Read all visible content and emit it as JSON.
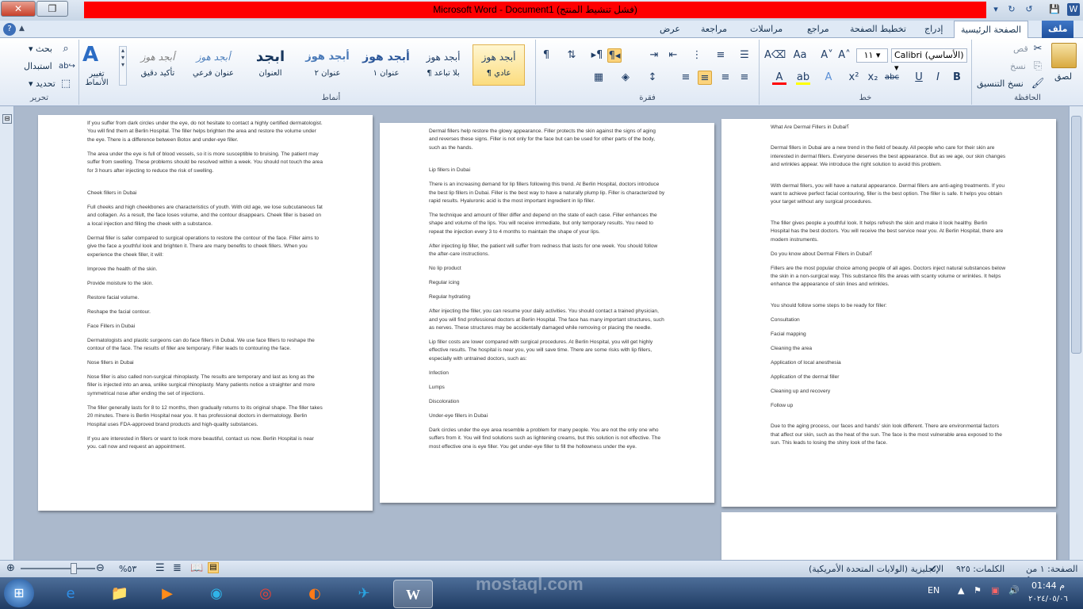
{
  "window": {
    "title": "Microsoft Word - Document1 (فشل تنشيط المنتج)",
    "buttons": {
      "minimize": "▁",
      "restore": "❐",
      "close": "✕"
    }
  },
  "tabs": [
    "ملف",
    "الصفحة الرئيسية",
    "إدراج",
    "تخطيط الصفحة",
    "مراجع",
    "مراسلات",
    "مراجعة",
    "عرض"
  ],
  "ribbon": {
    "clipboard": {
      "label": "الحافظة",
      "paste": "لصق",
      "cut": "قص",
      "copy": "نسخ",
      "format_painter": "نسخ التنسيق"
    },
    "font": {
      "label": "خط",
      "font_name": "Calibri (الأساسي)",
      "font_size": "١١"
    },
    "paragraph": {
      "label": "فقرة"
    },
    "styles": {
      "label": "أنماط",
      "items": [
        {
          "sample": "أبجد هوز",
          "name": "¶ عادي"
        },
        {
          "sample": "أبجد هوز",
          "name": "¶ بلا تباعد"
        },
        {
          "sample": "أبجد هوز",
          "name": "عنوان ١"
        },
        {
          "sample": "أبجد هوز",
          "name": "عنوان ٢"
        },
        {
          "sample": "ابجد",
          "name": "العنوان"
        },
        {
          "sample": "أبجد هوز",
          "name": "عنوان فرعي"
        },
        {
          "sample": "أبجد هوز",
          "name": "تأكيد دقيق"
        }
      ],
      "change_styles": "تغيير الأنماط"
    },
    "editing": {
      "label": "تحرير",
      "find": "بحث",
      "replace": "استبدال",
      "select": "تحديد"
    }
  },
  "pages": [
    {
      "paragraphs": [
        "What Are Dermal Fillers in Dubai؟",
        "Dermal fillers in Dubai are a new trend in the field of beauty. All people who care for their skin are interested in dermal fillers. Everyone deserves the best appearance. But as we age, our skin changes and wrinkles appear. We introduce the right solution to avoid this problem.",
        "With dermal fillers, you will have a natural appearance. Dermal fillers are anti-aging treatments. If you want to achieve perfect facial contouring, filler is the best option. The filler is safe. It helps you obtain your target without any surgical procedures.",
        "The filler gives people a youthful look. It helps refresh the skin and make it look healthy. Berlin Hospital has the best doctors. You will receive the best service near you. At Berlin Hospital, there are modern instruments.",
        "Do you know about Dermal Fillers in Dubai؟",
        "Fillers are the most popular choice among people of all ages. Doctors inject natural substances below the skin in a non-surgical way. This substance fills the areas with scanty volume or wrinkles. It helps enhance the appearance of skin lines and wrinkles.",
        "You should follow some steps to be ready for filler:",
        "Consultation",
        "Facial mapping",
        "Cleaning the area",
        "Application of local anesthesia",
        "Application of the dermal filler",
        "Cleaning up and recovery",
        "Follow up",
        "Due to the aging process, our faces and hands' skin look different. There are environmental factors that affect our skin, such as the heat of the sun. The face is the most vulnerable area exposed to the sun. This leads to losing the shiny look of the face."
      ]
    },
    {
      "paragraphs": [
        "Dermal fillers help restore the glowy appearance. Filler protects the skin against the signs of aging and reverses these signs. Filler is not only for the face but can be used for other parts of the body, such as the hands.",
        "Lip fillers in Dubai",
        "There is an increasing demand for lip fillers following this trend. At Berlin Hospital, doctors introduce the best lip fillers in Dubai. Filler is the best way to have a naturally plump lip. Filler is characterized by rapid results. Hyaluronic acid is the most important ingredient in lip filler.",
        "The technique and amount of filler differ and depend on the state of each case. Filler enhances the shape and volume of the lips. You will receive immediate, but only temporary results. You need to repeat the injection every 3 to 4 months to maintain the shape of your lips.",
        "After injecting lip filler, the patient will suffer from redness that lasts for one week. You should follow the after-care instructions.",
        "No lip product",
        "Regular icing",
        "Regular hydrating",
        "After injecting the filler, you can resume your daily activities. You should contact a trained physician, and you will find professional doctors at Berlin Hospital. The face has many important structures, such as nerves. These structures may be accidentally damaged while removing or placing the needle.",
        "Lip filler costs are lower compared with surgical procedures. At Berlin Hospital, you will get highly effective results. The hospital is near you, you will save time. There are some risks with lip fillers, especially with untrained doctors, such as:",
        "Infection",
        "Lumps",
        "Discoloration",
        "Under-eye fillers in Dubai",
        "Dark circles under the eye area resemble a problem for many people. You are not the only one who suffers from it. You will find solutions such as lightening creams, but this solution is not effective. The most effective one is eye filler. You get under-eye filler to fill the hollowness under the eye."
      ]
    },
    {
      "paragraphs": [
        "If you suffer from dark circles under the eye, do not hesitate to contact a highly certified dermatologist. You will find them at Berlin Hospital. The filler helps brighten the area and restore the volume under the eye. There is a difference between Botox and under-eye filler.",
        "The area under the eye is full of blood vessels, so it is more susceptible to bruising. The patient may suffer from swelling. These problems should be resolved within a week. You should not touch the area for 3 hours after injecting to reduce the risk of swelling.",
        "Cheek fillers in Dubai",
        "Full cheeks and high cheekbones are characteristics of youth. With old age, we lose subcutaneous fat and collagen. As a result, the face loses volume, and the contour disappears. Cheek filler is based on a local injection and filling the cheek with a substance.",
        "Dermal filler is safer compared to surgical operations to restore the contour of the face. Filler aims to give the face a youthful look and brighten it. There are many benefits to cheek fillers. When you experience the cheek filler, it will:",
        "Improve the health of the skin.",
        "Provide moisture to the skin.",
        "Restore facial volume.",
        "Reshape the facial contour.",
        "Face Fillers in Dubai",
        "Dermatologists and plastic surgeons can do face fillers in Dubai. We use face fillers to reshape the contour of the face. The results of filler are temporary. Filler leads to contouring the face.",
        "Nose fillers in Dubai",
        "Nose filler is also called non-surgical rhinoplasty. The results are temporary and last as long as the filler is injected into an area, unlike surgical rhinoplasty. Many patients notice a straighter and more symmetrical nose after ending the set of injections.",
        "The filler generally lasts for 8 to 12 months, then gradually returns to its original shape. The filler takes 20 minutes. There is Berlin Hospital near you. It has professional doctors in dermatology. Berlin Hospital uses FDA-approved brand products and high-quality substances.",
        "If you are interested in fillers or want to look more beautiful, contact us now. Berlin Hospital is near you. call now and request an appointment."
      ]
    }
  ],
  "statusbar": {
    "page": "الصفحة: ١ من ٤",
    "words": "الكلمات: ٩٢٥",
    "language": "الإنجليزية (الولايات المتحدة الأمريكية)",
    "zoom": "%٥٣"
  },
  "taskbar": {
    "lang": "EN",
    "time": "01:44 م",
    "date": "٢٠٢٤/٠٥/٠٦"
  },
  "watermark": "mostaql.com"
}
